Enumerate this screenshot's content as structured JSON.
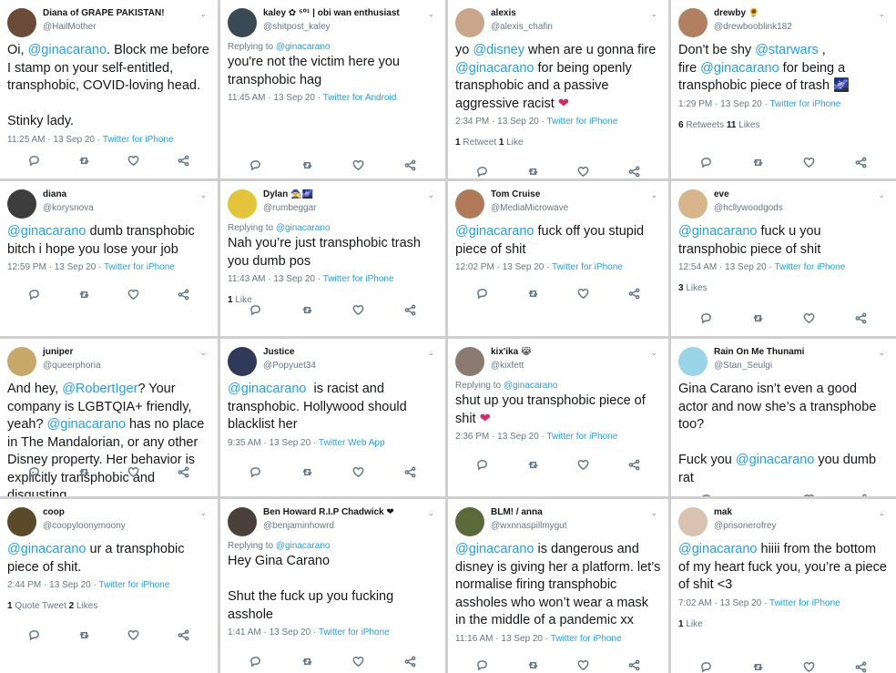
{
  "colors": {
    "link": "#1da1f2",
    "text": "#14171a",
    "muted": "#657786",
    "heart": "#e0245e"
  },
  "tweets": [
    {
      "name": "Diana of GRAPE PAKISTAN!",
      "handle": "@HailMother",
      "avatar": "#6b4a3a",
      "body": [
        [
          "Oi, ",
          ""
        ],
        [
          "@ginacarano",
          "m"
        ],
        [
          ". Block me before I stamp on your self-entitled, transphobic, COVID-loving head.\n\nStinky lady.",
          ""
        ]
      ],
      "time": "11:25 AM · 13 Sep 20 · ",
      "source": "Twitter for iPhone"
    },
    {
      "name": "kaley ✿ ⁵⁰¹ | obi wan enthusiast",
      "handle": "@shitpost_kaley",
      "avatar": "#3a4a55",
      "reply": "@ginacarano",
      "body": [
        [
          "you're not the victim here you transphobic hag",
          ""
        ]
      ],
      "time": "11:45 AM · 13 Sep 20 · ",
      "source": "Twitter for Android"
    },
    {
      "name": "alexis",
      "handle": "@alexis_chafin",
      "avatar": "#c9a58a",
      "body": [
        [
          "yo ",
          ""
        ],
        [
          "@disney",
          "m"
        ],
        [
          " when are u gonna fire ",
          ""
        ],
        [
          "@ginacarano",
          "m"
        ],
        [
          " for being openly transphobic and a passive aggressive racist ",
          ""
        ],
        [
          "❤",
          "h"
        ]
      ],
      "time": "2:34 PM · 13 Sep 20 · ",
      "source": "Twitter for iPhone",
      "stats": [
        [
          "1",
          "Retweet"
        ],
        [
          "1",
          "Like"
        ]
      ]
    },
    {
      "name": "drewby 🌻",
      "handle": "@drewbooblink182",
      "avatar": "#b08060",
      "body": [
        [
          "Don't be shy ",
          ""
        ],
        [
          "@starwars",
          "m"
        ],
        [
          " ,\nfire ",
          ""
        ],
        [
          "@ginacarano",
          "m"
        ],
        [
          " for being a transphobic piece of trash 🌌",
          ""
        ]
      ],
      "time": "1:29 PM · 13 Sep 20 · ",
      "source": "Twitter for iPhone",
      "stats": [
        [
          "6",
          "Retweets"
        ],
        [
          "11",
          "Likes"
        ]
      ]
    },
    {
      "name": "diana",
      "handle": "@korysnova",
      "avatar": "#3d3d3d",
      "body": [
        [
          "@ginacarano",
          "m"
        ],
        [
          " dumb transphobic bitch i hope you lose your job",
          ""
        ]
      ],
      "time": "12:59 PM · 13 Sep 20 · ",
      "source": "Twitter for iPhone"
    },
    {
      "name": "Dylan 🧙🌌",
      "handle": "@rumbeggar",
      "avatar": "#e4c43a",
      "reply": "@ginacarano",
      "body": [
        [
          "Nah you’re just transphobic trash you dumb pos",
          ""
        ]
      ],
      "time": "11:43 AM · 13 Sep 20 · ",
      "source": "Twitter for iPhone",
      "stats": [
        [
          "1",
          "Like"
        ]
      ]
    },
    {
      "name": "Tom Cruise",
      "handle": "@MediaMicrowave",
      "avatar": "#b07a5a",
      "body": [
        [
          "@ginacarano",
          "m"
        ],
        [
          " fuck off you stupid piece of shit",
          ""
        ]
      ],
      "time": "12:02 PM · 13 Sep 20 · ",
      "source": "Twitter for iPhone"
    },
    {
      "name": "eve",
      "handle": "@hcllywoodgods",
      "avatar": "#d8b48a",
      "body": [
        [
          "@ginacarano",
          "m"
        ],
        [
          " fuck u you transphobic piece of shit",
          ""
        ]
      ],
      "time": "12:54 AM · 13 Sep 20 · ",
      "source": "Twitter for iPhone",
      "stats": [
        [
          "3",
          "Likes"
        ]
      ]
    },
    {
      "name": "juniper",
      "handle": "@queerphoria",
      "avatar": "#c7a86a",
      "body": [
        [
          "And hey, ",
          ""
        ],
        [
          "@RobertIger",
          "m"
        ],
        [
          "? Your company is LGBTQIA+ friendly, yeah? ",
          ""
        ],
        [
          "@ginacarano",
          "m"
        ],
        [
          " has no place in The Mandalorian, or any other Disney property. Her behavior is explicitly transphobic and disgusting.",
          ""
        ]
      ],
      "time": "",
      "source": ""
    },
    {
      "name": "Justice",
      "handle": "@Popyuet34",
      "avatar": "#2f3a5a",
      "body": [
        [
          "@ginacarano",
          "m"
        ],
        [
          "  is racist and transphobic. Hollywood should blacklist her",
          ""
        ]
      ],
      "time": "9:35 AM · 13 Sep 20 · ",
      "source": "Twitter Web App"
    },
    {
      "name": "kix'ika 😹",
      "handle": "@kixfett",
      "avatar": "#8a7a70",
      "reply": "@ginacarano",
      "body": [
        [
          "shut up you transphobic piece of shit ",
          ""
        ],
        [
          "❤",
          "h"
        ]
      ],
      "time": "2:36 PM · 13 Sep 20 · ",
      "source": "Twitter for iPhone"
    },
    {
      "name": "Rain On Me Thunami",
      "handle": "@Stan_Seulgi",
      "avatar": "#9ad4e8",
      "body": [
        [
          "Gina Carano isn’t even a good actor and now she’s a transphobe too?\n\nFuck you ",
          ""
        ],
        [
          "@ginacarano",
          "m"
        ],
        [
          " you dumb rat",
          ""
        ]
      ],
      "time": "",
      "source": ""
    },
    {
      "name": "coop",
      "handle": "@coopyloonymoony",
      "avatar": "#5a4a2a",
      "body": [
        [
          "@ginacarano",
          "m"
        ],
        [
          " ur a transphobic piece of shit.",
          ""
        ]
      ],
      "time": "2:44 PM · 13 Sep 20 · ",
      "source": "Twitter for iPhone",
      "stats": [
        [
          "1",
          "Quote Tweet"
        ],
        [
          "2",
          "Likes"
        ]
      ]
    },
    {
      "name": "Ben Howard R.I.P Chadwick ❤",
      "handle": "@benjaminhowrd",
      "avatar": "#4a3f3a",
      "reply": "@ginacarano",
      "body": [
        [
          "Hey Gina Carano\n\nShut the fuck up you fucking asshole",
          ""
        ]
      ],
      "time": "1:41 AM · 13 Sep 20 · ",
      "source": "Twitter for iPhone"
    },
    {
      "name": "BLM! / anna",
      "handle": "@wxnnaspillmygut",
      "avatar": "#5a6a3a",
      "body": [
        [
          "@ginacarano",
          "m"
        ],
        [
          " is dangerous and disney is giving her a platform. let’s normalise firing transphobic assholes who won’t wear a mask in the middle of a pandemic xx",
          ""
        ]
      ],
      "time": "11:16 AM · 13 Sep 20 · ",
      "source": "Twitter for iPhone"
    },
    {
      "name": "mak",
      "handle": "@prisonerofrey",
      "avatar": "#d9c2b0",
      "body": [
        [
          "@ginacarano",
          "m"
        ],
        [
          " hiiii from the bottom of my heart fuck you, you’re a piece of shit <3",
          ""
        ]
      ],
      "time": "7:02 AM · 13 Sep 20 · ",
      "source": "Twitter for iPhone",
      "stats": [
        [
          "1",
          "Like"
        ]
      ]
    }
  ],
  "replying_label": "Replying to "
}
